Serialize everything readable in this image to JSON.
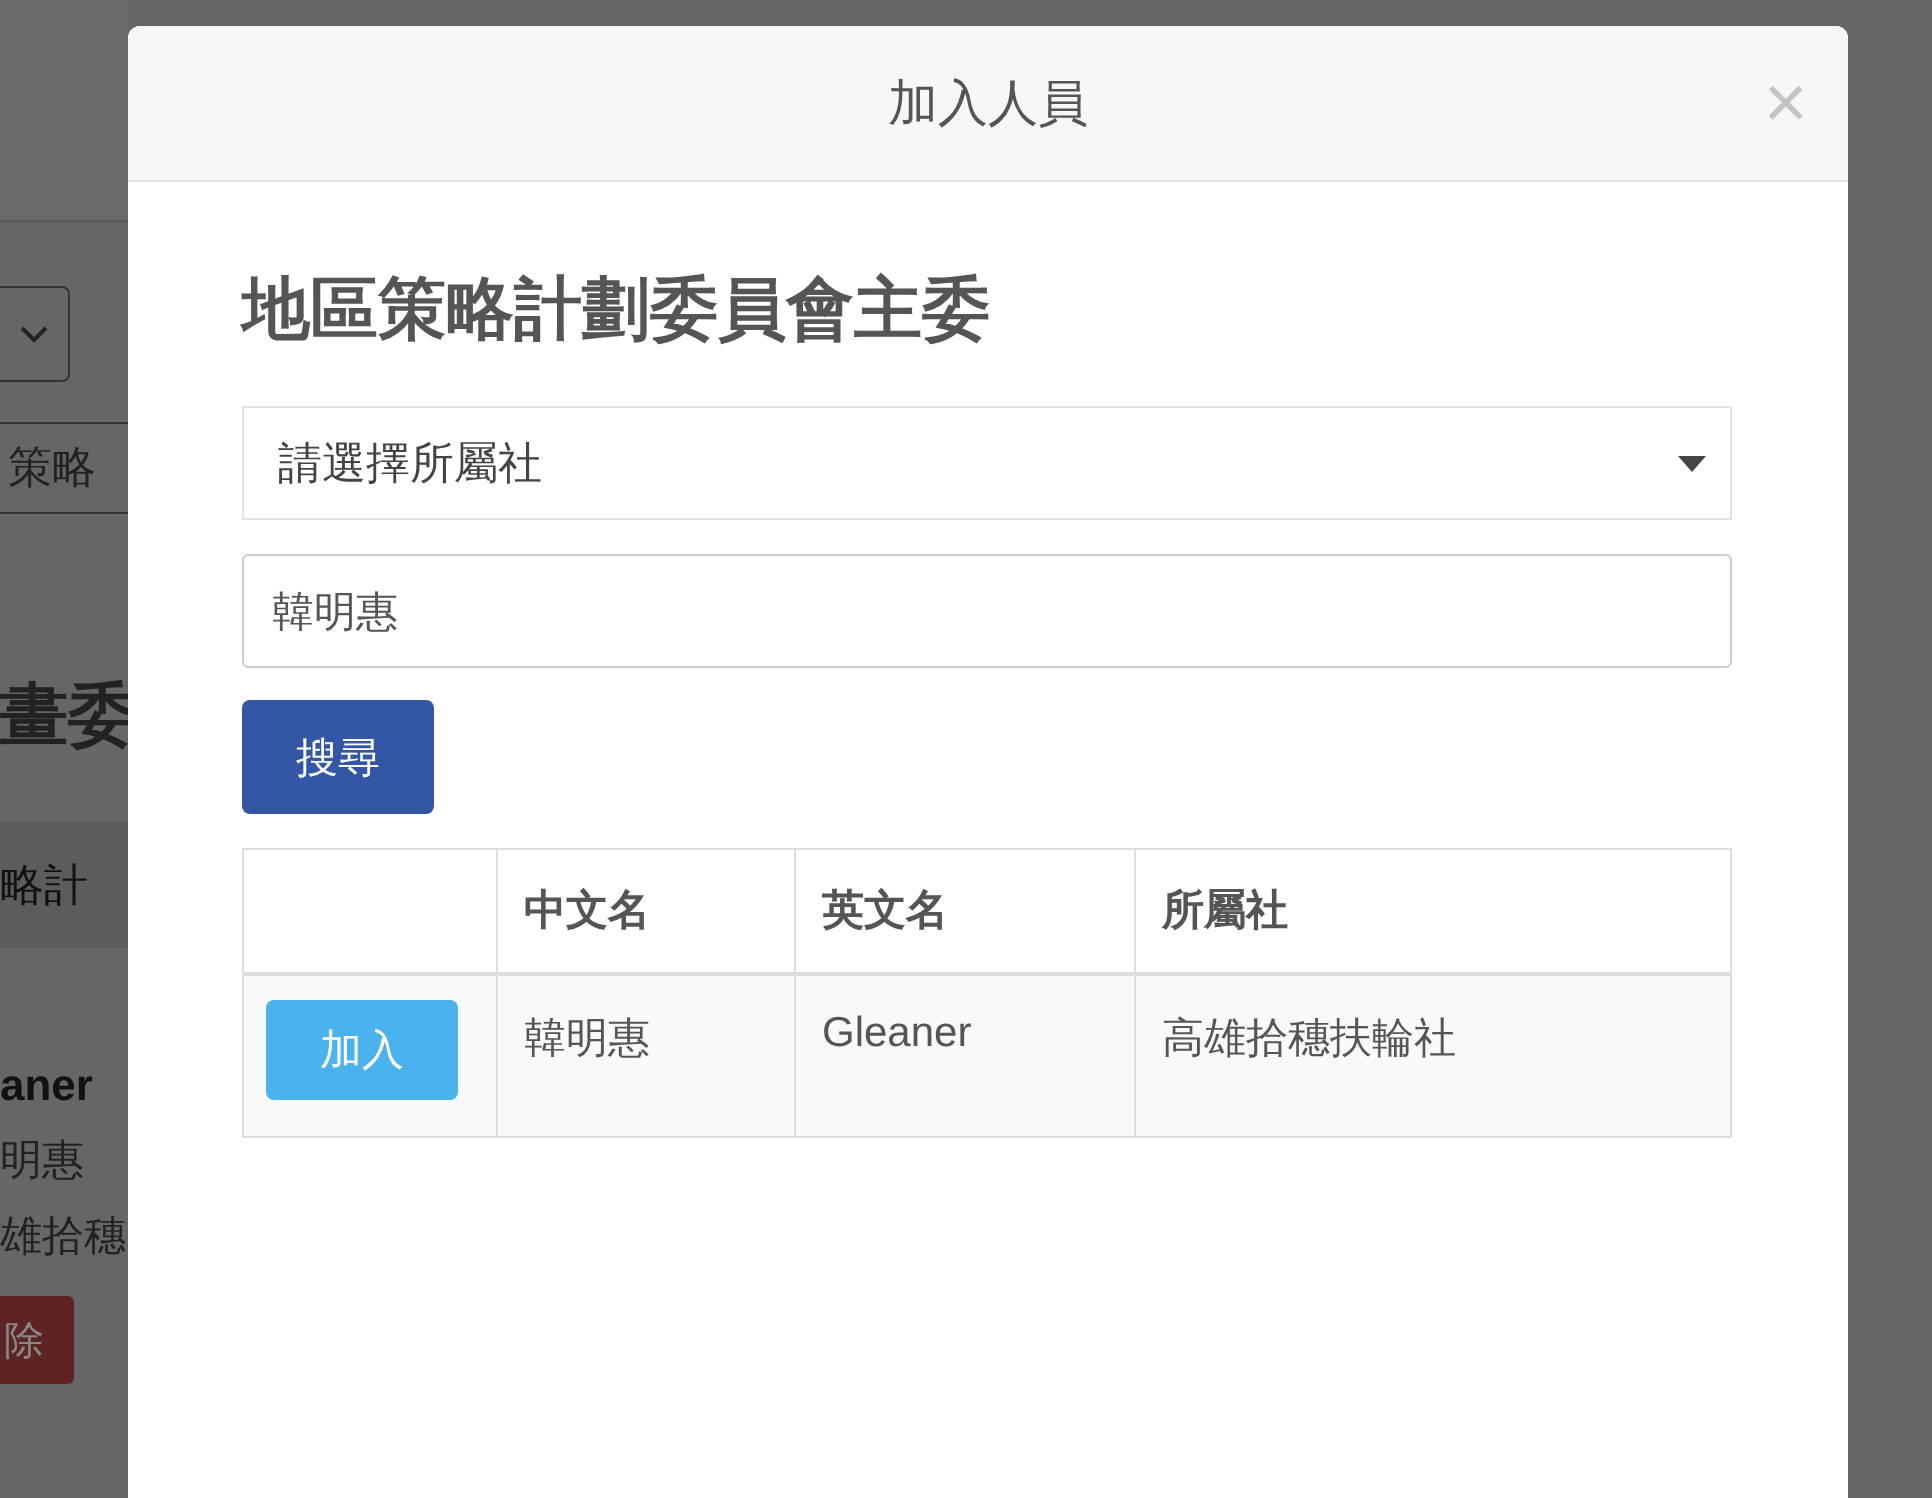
{
  "background_page": {
    "filter_chip": "策略",
    "heading": "畫委",
    "tab": "略計",
    "member": {
      "english_name": "aner",
      "chinese_name": "明惠",
      "club": "雄拾穗"
    },
    "delete_button": "除"
  },
  "modal": {
    "title": "加入人員",
    "close": "×",
    "heading": "地區策略計劃委員會主委",
    "club_select": {
      "placeholder": "請選擇所屬社"
    },
    "name_field": {
      "value": "韓明惠"
    },
    "search_button": "搜尋",
    "table": {
      "columns": [
        "中文名",
        "英文名",
        "所屬社"
      ],
      "rows": [
        {
          "action": "加入",
          "chinese_name": "韓明惠",
          "english_name": "Gleaner",
          "club": "高雄拾穗扶輪社"
        }
      ]
    }
  }
}
